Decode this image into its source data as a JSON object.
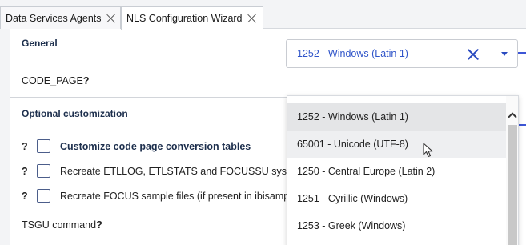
{
  "tabs": [
    {
      "label": "Data Services Agents",
      "active": false
    },
    {
      "label": "NLS Configuration Wizard",
      "active": true
    }
  ],
  "general": {
    "title": "General",
    "code_page_label": "CODE_PAGE",
    "help_mark": "?",
    "code_page_value": "1252 - Windows (Latin 1)"
  },
  "optional": {
    "title": "Optional customization",
    "rows": [
      {
        "label": "Customize code page conversion tables",
        "checked": false
      },
      {
        "label": "Recreate ETLLOG, ETLSTATS and FOCUSSU system file",
        "checked": false
      },
      {
        "label": "Recreate FOCUS sample files (if present in ibisamp)",
        "checked": false
      }
    ],
    "tsgu_label": "TSGU command"
  },
  "dropdown": {
    "options": [
      "1252 - Windows (Latin 1)",
      "65001 - Unicode (UTF-8)",
      "1250 - Central Europe (Latin 2)",
      "1251 - Cyrillic (Windows)",
      "1253 - Greek (Windows)"
    ],
    "selected_index": 0,
    "hover_index": 1
  },
  "colors": {
    "accent": "#2f54c9",
    "section_title": "#1d2f4d"
  },
  "icons": [
    "close-icon",
    "clear-icon",
    "chevron-down-icon",
    "chevron-up-icon",
    "mouse-cursor-icon"
  ]
}
